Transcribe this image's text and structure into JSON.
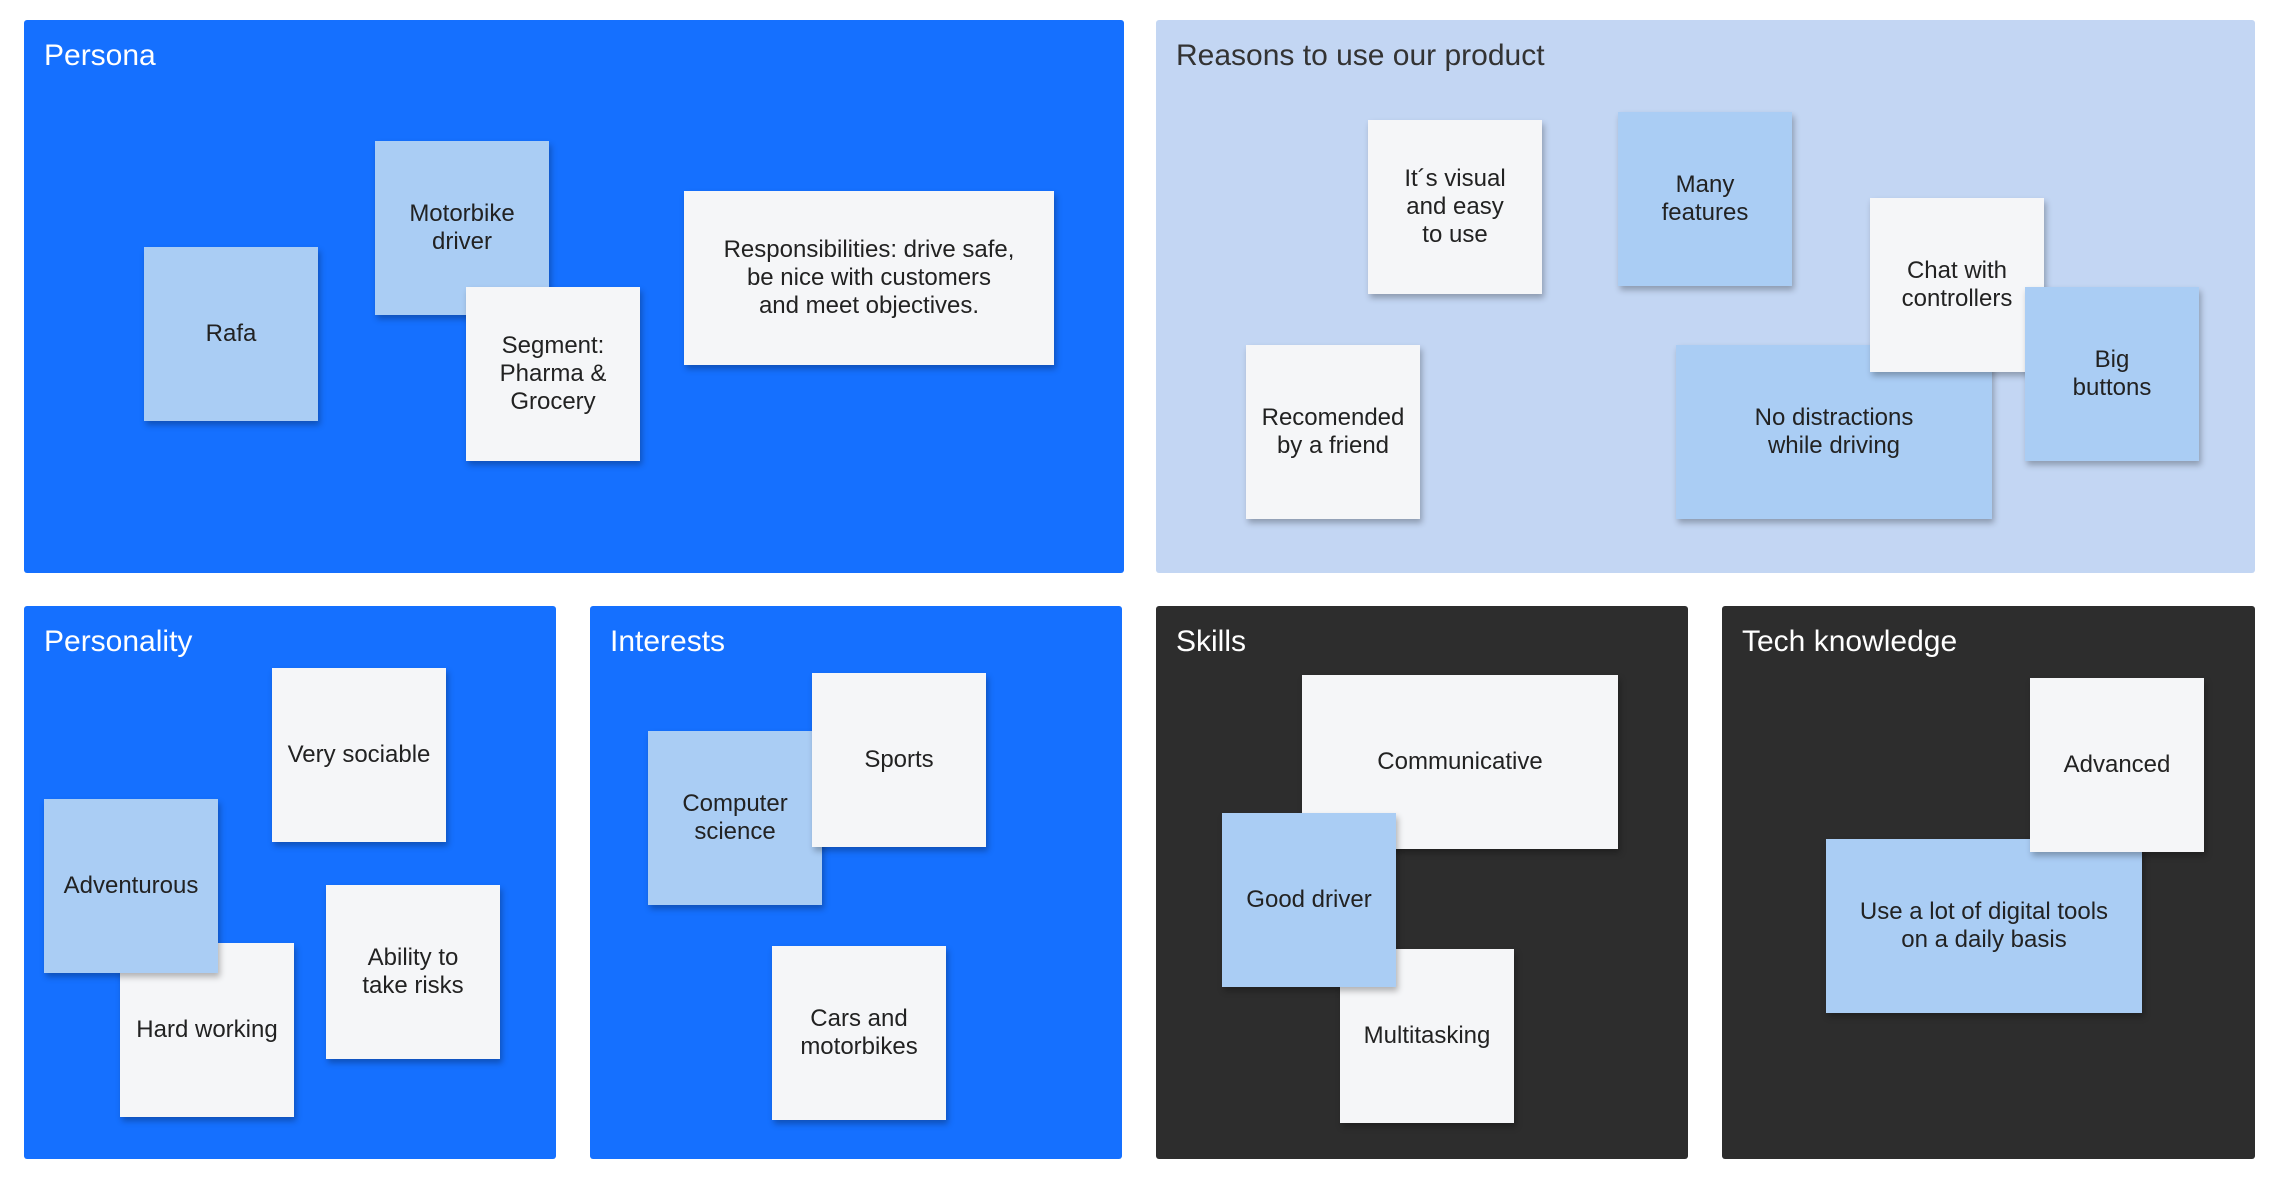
{
  "colors": {
    "panel_blue": "#1570ff",
    "panel_light": "#c3d6f3",
    "panel_dark": "#2d2d2d",
    "note_white": "#f5f6f8",
    "note_light_blue": "#aacdf4"
  },
  "panels": {
    "persona": {
      "title": "Persona",
      "notes": {
        "rafa": "Rafa",
        "motorbike_driver": "Motorbike\ndriver",
        "segment": "Segment:\nPharma &\nGrocery",
        "responsibilities": "Responsibilities: drive safe,\nbe nice with customers\nand meet objectives."
      }
    },
    "reasons": {
      "title": "Reasons to use our product",
      "notes": {
        "visual": "It´s visual\nand easy\nto use",
        "many_features": "Many\nfeatures",
        "chat": "Chat with\ncontrollers",
        "recomended": "Recomended\nby a friend",
        "no_distractions": "No distractions\nwhile driving",
        "big_buttons": "Big\nbuttons"
      }
    },
    "personality": {
      "title": "Personality",
      "notes": {
        "very_sociable": "Very sociable",
        "adventurous": "Adventurous",
        "ability": "Ability to\ntake risks",
        "hard_working": "Hard working"
      }
    },
    "interests": {
      "title": "Interests",
      "notes": {
        "sports": "Sports",
        "computer_science": "Computer\nscience",
        "cars": "Cars and\nmotorbikes"
      }
    },
    "skills": {
      "title": "Skills",
      "notes": {
        "communicative": "Communicative",
        "good_driver": "Good driver",
        "multitasking": "Multitasking"
      }
    },
    "tech": {
      "title": "Tech knowledge",
      "notes": {
        "advanced": "Advanced",
        "digital_tools": "Use a lot of digital tools\non a daily basis"
      }
    }
  }
}
